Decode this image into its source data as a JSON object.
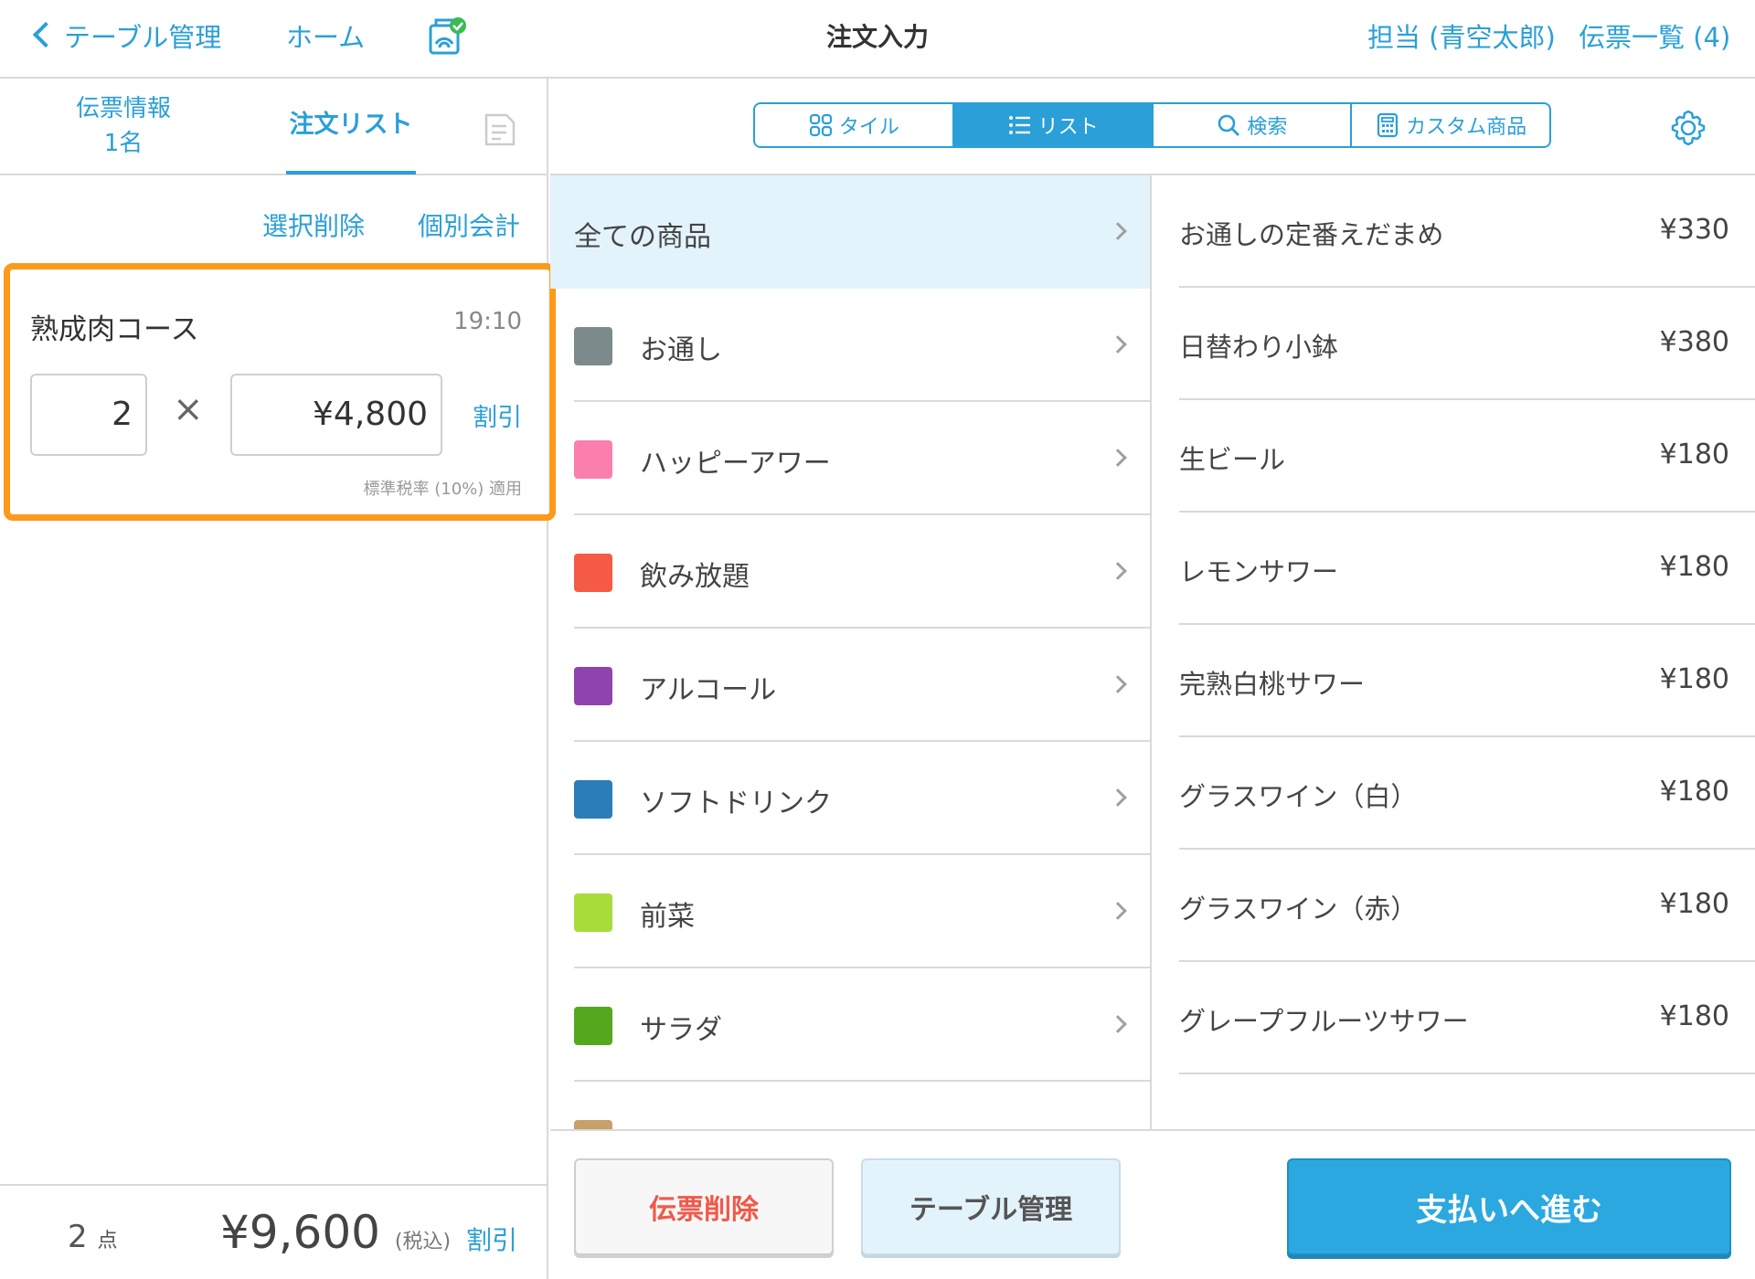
{
  "header": {
    "back_label": "テーブル管理",
    "home_label": "ホーム",
    "title": "注文入力",
    "staff_label": "担当 (青空太郎)",
    "slips_label": "伝票一覧 (4)"
  },
  "left_tabs": {
    "slip_info_line1": "伝票情報",
    "slip_info_line2": "1名",
    "order_list": "注文リスト"
  },
  "left_actions": {
    "delete_selected": "選択削除",
    "individual_bill": "個別会計"
  },
  "order_item": {
    "name": "熟成肉コース",
    "time": "19:10",
    "quantity": "2",
    "times_symbol": "×",
    "unit_price": "¥4,800",
    "discount_label": "割引",
    "tax_note": "標準税率 (10%) 適用"
  },
  "footer_summary": {
    "points_value": "2",
    "points_unit": "点",
    "total": "¥9,600",
    "tax_included": "(税込)",
    "discount_label": "割引"
  },
  "view_modes": {
    "tile": "タイル",
    "list": "リスト",
    "search": "検索",
    "custom": "カスタム商品"
  },
  "categories": [
    {
      "label": "全ての商品",
      "color": null
    },
    {
      "label": "お通し",
      "color": "#7d8a8c"
    },
    {
      "label": "ハッピーアワー",
      "color": "#fb7fad"
    },
    {
      "label": "飲み放題",
      "color": "#f55a47"
    },
    {
      "label": "アルコール",
      "color": "#8e44ad"
    },
    {
      "label": "ソフトドリンク",
      "color": "#2a7db8"
    },
    {
      "label": "前菜",
      "color": "#a8dc3a"
    },
    {
      "label": "サラダ",
      "color": "#55a81e"
    },
    {
      "label": "",
      "color": "#c8a06a"
    }
  ],
  "products": [
    {
      "name": "お通しの定番えだまめ",
      "price": "¥330"
    },
    {
      "name": "日替わり小鉢",
      "price": "¥380"
    },
    {
      "name": "生ビール",
      "price": "¥180"
    },
    {
      "name": "レモンサワー",
      "price": "¥180"
    },
    {
      "name": "完熟白桃サワー",
      "price": "¥180"
    },
    {
      "name": "グラスワイン（白）",
      "price": "¥180"
    },
    {
      "name": "グラスワイン（赤）",
      "price": "¥180"
    },
    {
      "name": "グレープフルーツサワー",
      "price": "¥180"
    },
    {
      "name": "",
      "price": ""
    }
  ],
  "bottom_actions": {
    "delete_slip": "伝票削除",
    "table_manage": "テーブル管理",
    "proceed_pay": "支払いへ進む"
  },
  "colors": {
    "accent": "#2a9fd8",
    "highlight_border": "#fd9a1c",
    "delete_text": "#f0594a"
  }
}
